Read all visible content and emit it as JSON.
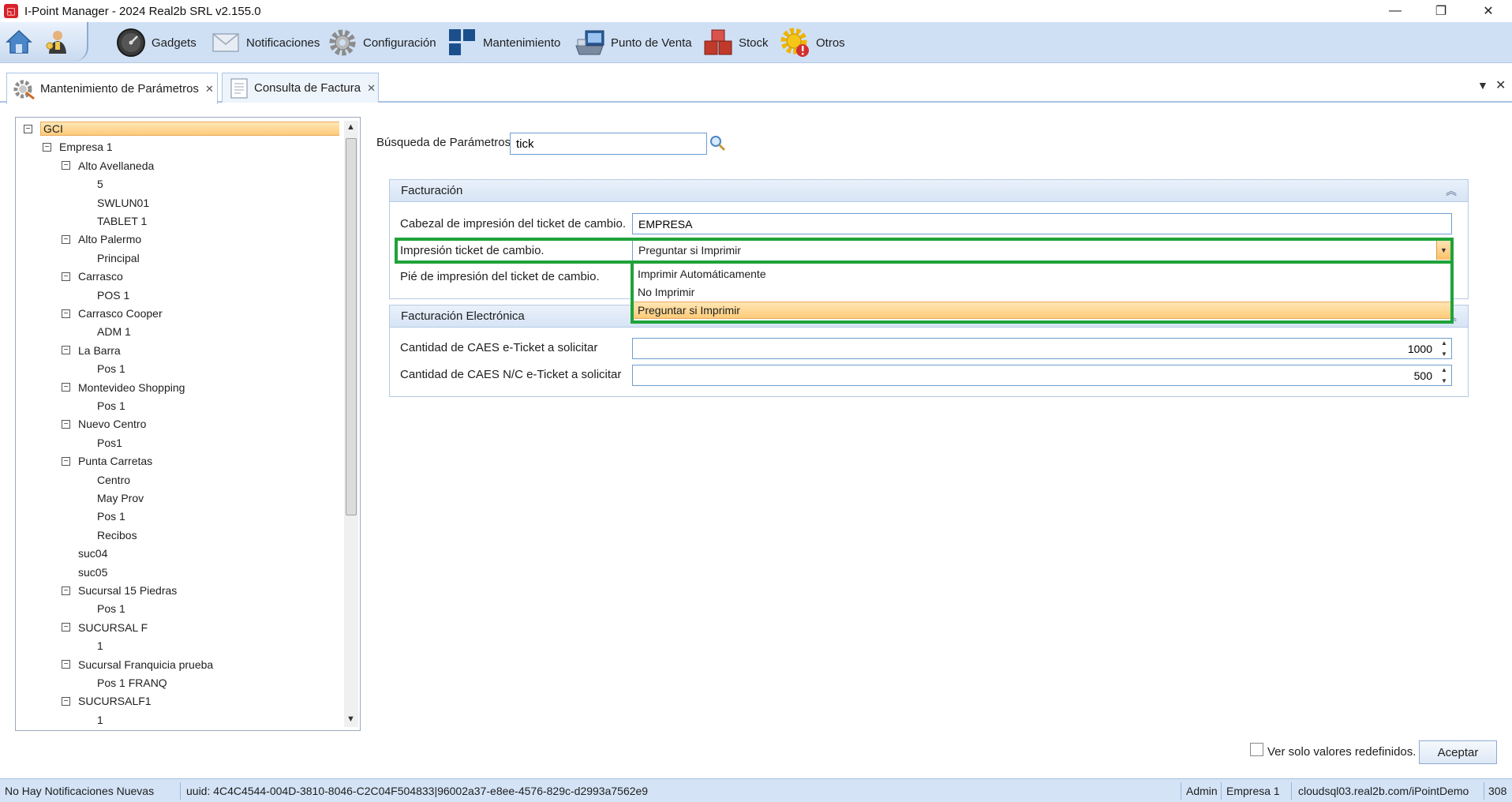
{
  "window": {
    "title": "I-Point Manager - 2024 Real2b SRL v2.155.0"
  },
  "toolbar": {
    "items": [
      {
        "label": "Gadgets",
        "icon": "gauge-icon"
      },
      {
        "label": "Notificaciones",
        "icon": "envelope-icon"
      },
      {
        "label": "Configuración",
        "icon": "gear-icon"
      },
      {
        "label": "Mantenimiento",
        "icon": "tiles-icon"
      },
      {
        "label": "Punto de Venta",
        "icon": "pos-terminal-icon"
      },
      {
        "label": "Stock",
        "icon": "boxes-icon"
      },
      {
        "label": "Otros",
        "icon": "gear-alert-icon"
      }
    ]
  },
  "tabs": [
    {
      "label": "Mantenimiento de Parámetros",
      "close": "✕",
      "active": true
    },
    {
      "label": "Consulta de Factura",
      "close": "✕",
      "active": false
    }
  ],
  "tree": {
    "nodes": [
      {
        "label": "GCI",
        "level": 0,
        "toggle": "⊟",
        "selected": true
      },
      {
        "label": "Empresa 1",
        "level": 1,
        "toggle": "⊟"
      },
      {
        "label": "Alto Avellaneda",
        "level": 2,
        "toggle": "⊟"
      },
      {
        "label": "5",
        "level": 3
      },
      {
        "label": "SWLUN01",
        "level": 3
      },
      {
        "label": "TABLET 1",
        "level": 3
      },
      {
        "label": "Alto Palermo",
        "level": 2,
        "toggle": "⊟"
      },
      {
        "label": "Principal",
        "level": 3
      },
      {
        "label": "Carrasco",
        "level": 2,
        "toggle": "⊟"
      },
      {
        "label": "POS 1",
        "level": 3
      },
      {
        "label": "Carrasco Cooper",
        "level": 2,
        "toggle": "⊟"
      },
      {
        "label": "ADM 1",
        "level": 3
      },
      {
        "label": "La Barra",
        "level": 2,
        "toggle": "⊟"
      },
      {
        "label": "Pos 1",
        "level": 3
      },
      {
        "label": "Montevideo Shopping",
        "level": 2,
        "toggle": "⊟"
      },
      {
        "label": "Pos 1",
        "level": 3
      },
      {
        "label": "Nuevo Centro",
        "level": 2,
        "toggle": "⊟"
      },
      {
        "label": "Pos1",
        "level": 3
      },
      {
        "label": "Punta Carretas",
        "level": 2,
        "toggle": "⊟"
      },
      {
        "label": "Centro",
        "level": 3
      },
      {
        "label": "May Prov",
        "level": 3
      },
      {
        "label": "Pos 1",
        "level": 3
      },
      {
        "label": "Recibos",
        "level": 3
      },
      {
        "label": "suc04",
        "level": 2
      },
      {
        "label": "suc05",
        "level": 2
      },
      {
        "label": "Sucursal 15 Piedras",
        "level": 2,
        "toggle": "⊟"
      },
      {
        "label": "Pos 1",
        "level": 3
      },
      {
        "label": "SUCURSAL F",
        "level": 2,
        "toggle": "⊟"
      },
      {
        "label": "1",
        "level": 3
      },
      {
        "label": "Sucursal Franquicia prueba",
        "level": 2,
        "toggle": "⊟"
      },
      {
        "label": "Pos 1 FRANQ",
        "level": 3
      },
      {
        "label": "SUCURSALF1",
        "level": 2,
        "toggle": "⊟"
      },
      {
        "label": "1",
        "level": 3
      }
    ]
  },
  "search": {
    "label": "Búsqueda de Parámetros",
    "value": "tick"
  },
  "facturacion": {
    "title": "Facturación",
    "cabezal_label": "Cabezal de impresión del ticket de cambio.",
    "cabezal_value": "EMPRESA",
    "impresion_label": "Impresión ticket de cambio.",
    "impresion_value": "Preguntar si Imprimir",
    "pie_label": "Pié de impresión del ticket de cambio.",
    "options": [
      "Imprimir Automáticamente",
      "No Imprimir",
      "Preguntar si Imprimir"
    ],
    "selected_option": "Preguntar si Imprimir"
  },
  "facturacion_electronica": {
    "title": "Facturación Electrónica",
    "caes_label": "Cantidad de CAES e-Ticket a solicitar",
    "caes_value": "1000",
    "caes_nc_label": "Cantidad de CAES N/C e-Ticket a solicitar",
    "caes_nc_value": "500"
  },
  "bottom": {
    "redef_label": "Ver solo valores redefinidos.",
    "accept_label": "Aceptar"
  },
  "status": {
    "notifications": "No Hay Notificaciones Nuevas",
    "uuid": "uuid: 4C4C4544-004D-3810-8046-C2C04F504833|96002a37-e8ee-4576-829c-d2993a7562e9",
    "user": "Admin",
    "company": "Empresa 1",
    "server": "cloudsql03.real2b.com/iPointDemo",
    "code": "308"
  },
  "colors": {
    "accent": "#cfe0f5",
    "highlight_box": "#1fa33a",
    "selection": "#fdcb7a"
  }
}
